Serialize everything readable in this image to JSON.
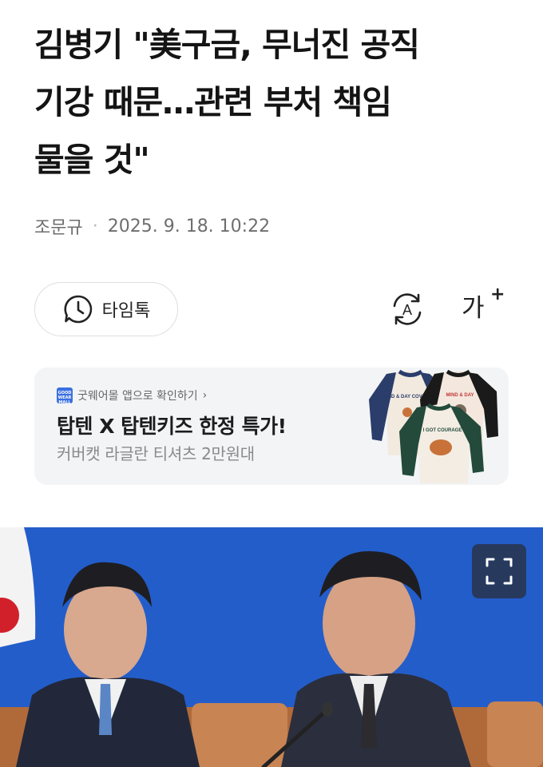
{
  "article": {
    "headline": "김병기 \"美구금, 무너진 공직\n기강 때문…관련 부처 책임\n물을 것\"",
    "author": "조문규",
    "datetime": "2025. 9. 18. 10:22"
  },
  "toolbar": {
    "timetalk_label": "타임톡",
    "translate_icon": "translate-icon",
    "fontsize_label": "가",
    "fontsize_plus": "+"
  },
  "ad": {
    "source": "굿웨어몰 앱으로 확인하기",
    "source_chevron": "›",
    "logo_text": "GOOD WEAR MALL",
    "title": "탑텐 X 탑텐키즈 한정 특가!",
    "subtitle": "커버캣 라글란 티셔츠 2만원대",
    "shirt_texts": [
      "MIND & DAY COVERCAT",
      "MIND & DAY",
      "I GOT COURAGE"
    ]
  },
  "photo": {
    "expand_icon": "expand-icon"
  },
  "colors": {
    "photo_background": "#1f58c4",
    "ad_background": "#f3f4f6",
    "meta_text": "#6e6e6e"
  }
}
